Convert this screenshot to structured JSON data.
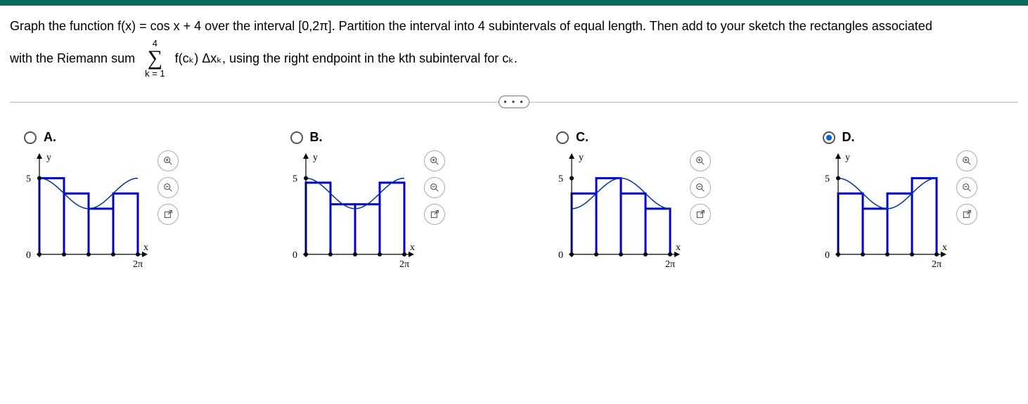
{
  "question": {
    "line1": "Graph the function f(x) = cos x + 4 over the interval [0,2π]. Partition the interval into 4 subintervals of equal length. Then add to your sketch the rectangles associated",
    "line2_pre": "with the Riemann sum",
    "sum_top": "4",
    "sum_bot": "k = 1",
    "line2_post": "f(cₖ) Δxₖ, using the right endpoint in the kth subinterval for cₖ."
  },
  "ellipsis": "• • •",
  "options": [
    {
      "label": "A.",
      "selected": false
    },
    {
      "label": "B.",
      "selected": false
    },
    {
      "label": "C.",
      "selected": false
    },
    {
      "label": "D.",
      "selected": true
    }
  ],
  "axis": {
    "y_label": "y",
    "x_label": "x",
    "y_tick": "5",
    "y_origin": "0",
    "x_tick": "2π"
  },
  "tools": {
    "zoom_in": "zoom-in",
    "zoom_out": "zoom-out",
    "popout": "popout"
  },
  "chart_data": [
    {
      "option": "A",
      "type": "line+bar",
      "curve": "y = cos(x) + 4",
      "x_range": [
        0,
        6.2832
      ],
      "y_range": [
        0,
        6
      ],
      "bars_xwidth": 1.5708,
      "style": "left-endpoint",
      "bars": [
        {
          "x_left": 0.0,
          "height": 5.0
        },
        {
          "x_left": 1.5708,
          "height": 4.0
        },
        {
          "x_left": 3.1416,
          "height": 3.0
        },
        {
          "x_left": 4.7124,
          "height": 4.0
        }
      ]
    },
    {
      "option": "B",
      "type": "line+bar",
      "curve": "y = cos(x) + 4",
      "x_range": [
        0,
        6.2832
      ],
      "y_range": [
        0,
        6
      ],
      "bars_xwidth": 1.5708,
      "style": "midpoint",
      "bars": [
        {
          "x_left": 0.0,
          "height": 4.71
        },
        {
          "x_left": 1.5708,
          "height": 3.29
        },
        {
          "x_left": 3.1416,
          "height": 3.29
        },
        {
          "x_left": 4.7124,
          "height": 4.71
        }
      ]
    },
    {
      "option": "C",
      "type": "line+bar",
      "curve": "y = -cos(x) + 4",
      "x_range": [
        0,
        6.2832
      ],
      "y_range": [
        0,
        6
      ],
      "bars_xwidth": 1.5708,
      "style": "right-endpoint",
      "bars": [
        {
          "x_left": 0.0,
          "height": 4.0
        },
        {
          "x_left": 1.5708,
          "height": 5.0
        },
        {
          "x_left": 3.1416,
          "height": 4.0
        },
        {
          "x_left": 4.7124,
          "height": 3.0
        }
      ]
    },
    {
      "option": "D",
      "type": "line+bar",
      "curve": "y = cos(x) + 4",
      "x_range": [
        0,
        6.2832
      ],
      "y_range": [
        0,
        6
      ],
      "bars_xwidth": 1.5708,
      "style": "right-endpoint",
      "bars": [
        {
          "x_left": 0.0,
          "height": 4.0
        },
        {
          "x_left": 1.5708,
          "height": 3.0
        },
        {
          "x_left": 3.1416,
          "height": 4.0
        },
        {
          "x_left": 4.7124,
          "height": 5.0
        }
      ]
    }
  ]
}
